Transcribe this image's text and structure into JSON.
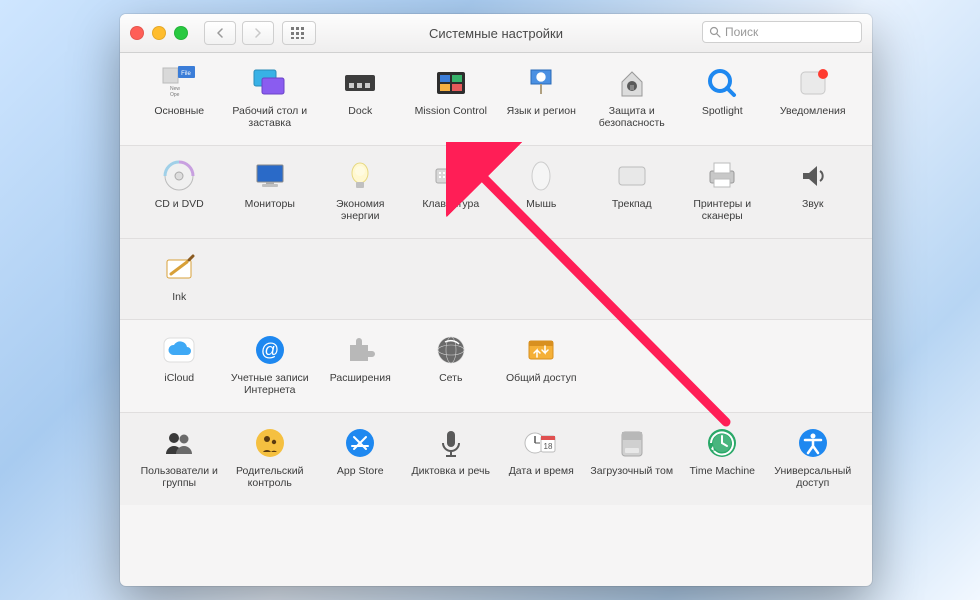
{
  "window": {
    "title": "Системные настройки"
  },
  "search": {
    "placeholder": "Поиск"
  },
  "sections": [
    {
      "items": [
        {
          "id": "general",
          "label": "Основные"
        },
        {
          "id": "desktop",
          "label": "Рабочий стол и заставка"
        },
        {
          "id": "dock",
          "label": "Dock"
        },
        {
          "id": "mission",
          "label": "Mission Control"
        },
        {
          "id": "language",
          "label": "Язык и регион"
        },
        {
          "id": "security",
          "label": "Защита и безопасность"
        },
        {
          "id": "spotlight",
          "label": "Spotlight"
        },
        {
          "id": "notifications",
          "label": "Уведомления"
        }
      ]
    },
    {
      "items": [
        {
          "id": "cddvd",
          "label": "CD и DVD"
        },
        {
          "id": "displays",
          "label": "Мониторы"
        },
        {
          "id": "energy",
          "label": "Экономия энергии"
        },
        {
          "id": "keyboard",
          "label": "Клавиатура"
        },
        {
          "id": "mouse",
          "label": "Мышь"
        },
        {
          "id": "trackpad",
          "label": "Трекпад"
        },
        {
          "id": "printers",
          "label": "Принтеры и сканеры"
        },
        {
          "id": "sound",
          "label": "Звук"
        }
      ]
    },
    {
      "items": [
        {
          "id": "ink",
          "label": "Ink"
        }
      ]
    },
    {
      "items": [
        {
          "id": "icloud",
          "label": "iCloud"
        },
        {
          "id": "internet",
          "label": "Учетные записи Интернета"
        },
        {
          "id": "extensions",
          "label": "Расширения"
        },
        {
          "id": "network",
          "label": "Сеть"
        },
        {
          "id": "sharing",
          "label": "Общий доступ"
        }
      ]
    },
    {
      "items": [
        {
          "id": "users",
          "label": "Пользователи и группы"
        },
        {
          "id": "parental",
          "label": "Родительский контроль"
        },
        {
          "id": "appstore",
          "label": "App Store"
        },
        {
          "id": "dictation",
          "label": "Диктовка и речь"
        },
        {
          "id": "datetime",
          "label": "Дата и время"
        },
        {
          "id": "startup",
          "label": "Загрузочный том"
        },
        {
          "id": "timemachine",
          "label": "Time Machine"
        },
        {
          "id": "accessibility",
          "label": "Универсальный доступ"
        }
      ]
    }
  ],
  "arrow_target": "mission"
}
